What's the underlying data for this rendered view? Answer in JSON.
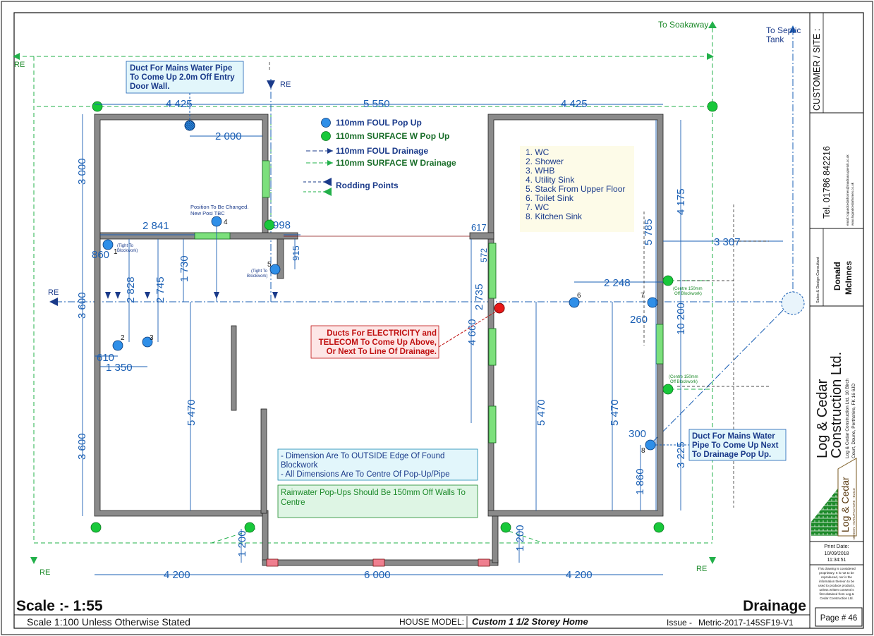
{
  "labels": {
    "to_soakaway": "To Soakaway",
    "to_septic": [
      "To Septic",
      "Tank"
    ],
    "re": "RE"
  },
  "dimensions": {
    "top": [
      "4 425",
      "5 550",
      "4 425"
    ],
    "bottom": [
      "4 200",
      "6 000",
      "4 200"
    ],
    "left": [
      "3 000",
      "3 600",
      "3 600"
    ],
    "interior": {
      "d2000": "2 000",
      "d2841": "2 841",
      "d998": "998",
      "d617": "617",
      "d572": "572",
      "d860": "860",
      "d2828": "2 828",
      "d2745": "2 745",
      "d1730": "1 730",
      "d915": "915",
      "d2735": "2 735",
      "d4660": "4 660",
      "d610": "610",
      "d1350": "1 350",
      "d5470a": "5 470",
      "d5470b": "5 470",
      "d5470c": "5 470",
      "d5785": "5 785",
      "d4175": "4 175",
      "d3307": "3 307",
      "d2248": "2 248",
      "d260": "260",
      "d10200": "10 200",
      "d300": "300",
      "d1860": "1 860",
      "d3225": "3 225",
      "d1200a": "1 200",
      "d1200b": "1 200"
    }
  },
  "notes": {
    "duct_water_top": [
      "Duct For Mains Water Pipe",
      "To Come Up 2.0m Off Entry",
      "Door Wall."
    ],
    "duct_water_right": [
      "Duct For Mains Water",
      "Pipe To Come Up Next",
      "To Drainage Pop Up."
    ],
    "electricity": [
      "Ducts For ELECTRICITY and",
      "TELECOM To Come Up Above,",
      "Or Next To Line Of Drainage."
    ],
    "dimensions_note": [
      "- Dimension Are To OUTSIDE Edge Of Found",
      "Blockwork",
      "- All Dimensions Are To Centre Of Pop-Up/Pipe"
    ],
    "rainwater_note": [
      "Rainwater Pop-Ups Should Be 150mm Off Walls To",
      "Centre"
    ],
    "position_changed": [
      "Position To Be Changed.",
      "New Posi TBC"
    ],
    "tight_blockwork": [
      "(Tight To",
      "Blockwork)"
    ],
    "centre_150": [
      "(Centre 150mm",
      "Off Blockwork)"
    ]
  },
  "legend": [
    {
      "label": "110mm FOUL Pop Up",
      "color": "#2f8fe8"
    },
    {
      "label": "110mm SURFACE W Pop Up",
      "color": "#18c83a"
    },
    {
      "label": "110mm FOUL Drainage",
      "color": "#1a3a8a"
    },
    {
      "label": "110mm SURFACE W Drainage",
      "color": "#1a6e2a"
    },
    {
      "label": "Rodding Points",
      "color": "#1a3a8a"
    }
  ],
  "fixtures": [
    "1. WC",
    "2. Shower",
    "3. WHB",
    "4. Utility Sink",
    "5. Stack From Upper Floor",
    "6. Toilet Sink",
    "7. WC",
    "8. Kitchen Sink"
  ],
  "point_numbers": [
    "1",
    "2",
    "3",
    "4",
    "5",
    "6",
    "7",
    "8"
  ],
  "footer": {
    "scale_big": "Scale :- 1:55",
    "scale_small": "Scale 1:100 Unless Otherwise Stated",
    "title": "Drainage",
    "house_model_label": "HOUSE MODEL:",
    "house_model_value": "Custom 1 1/2 Storey Home",
    "issue_label": "Issue -",
    "issue_value": "Metric-2017-145SF19-V1",
    "page": "Page # 46"
  },
  "title_block": {
    "customer": "CUSTOMER / SITE :",
    "tel": "Tel. 01786 842216",
    "emails": [
      "email: logandcedarhomes@madrana.gnetuk.co.uk",
      "www.logandcedarhomes.co.uk"
    ],
    "consultant_label": "Sales & Design Consultant",
    "consultant_name": [
      "Donald",
      "McInnes"
    ],
    "company": [
      "Log & Cedar",
      "Construction Ltd."
    ],
    "address": [
      "Log & Cedar Construction Ltd. 10 Birch",
      "Court, Doune, Perthshire, FK 16 6JD"
    ],
    "logo_text": [
      "Log & Cedar",
      "DESIGN - MANUFACTURE - BUILD"
    ],
    "print_date_label": "Print Date:",
    "print_date": "10/09/2018",
    "print_time": "11:34:51",
    "disclaimer": [
      "This drawing is considered",
      "proprietary. It is not to be",
      "reproduced, nor is the",
      "information thereon to be",
      "used to produce products,",
      "unless written consent is",
      "first obtained from Log &",
      "Cedar Construction Ltd."
    ]
  }
}
